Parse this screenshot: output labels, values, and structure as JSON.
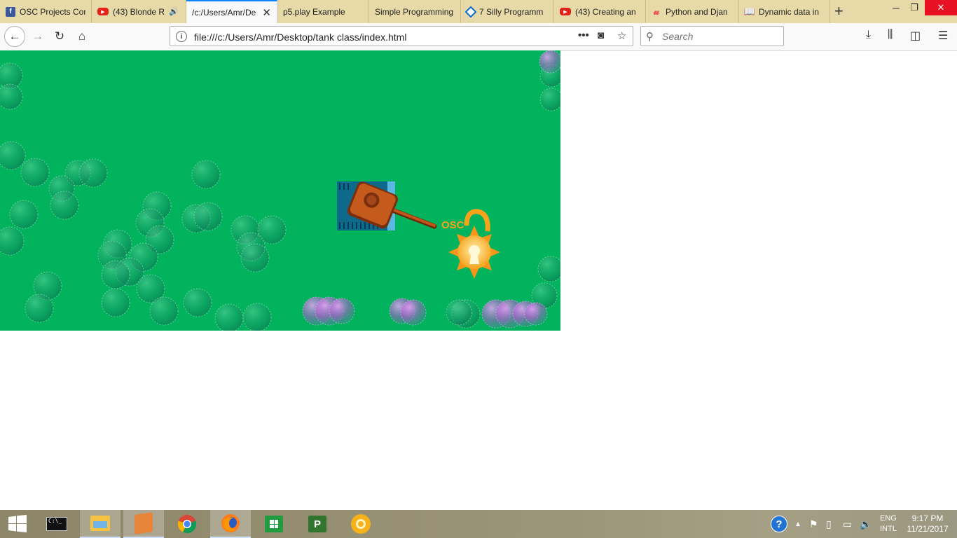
{
  "tabs": [
    {
      "title": "OSC Projects Cor",
      "icon": "facebook-icon"
    },
    {
      "title": "(43) Blonde R",
      "icon": "youtube-icon",
      "audio": true
    },
    {
      "title": "/c:/Users/Amr/De",
      "active": true
    },
    {
      "title": "p5.play Example",
      "icon": "page-icon"
    },
    {
      "title": "Simple Programming",
      "icon": "page-icon"
    },
    {
      "title": "7 Silly Programm",
      "icon": "diamond-icon"
    },
    {
      "title": "(43) Creating an",
      "icon": "youtube-icon"
    },
    {
      "title": "Python and Djan",
      "icon": "udemy-icon"
    },
    {
      "title": "Dynamic data in",
      "icon": "book-icon"
    }
  ],
  "nav": {
    "url": "file:///c:/Users/Amr/Desktop/tank class/index.html",
    "search_placeholder": "Search"
  },
  "game": {
    "badge_text": "OSC"
  },
  "tray": {
    "lang1": "ENG",
    "lang2": "INTL",
    "time": "9:17 PM",
    "date": "11/21/2017"
  },
  "colors": {
    "canvas_bg": "#00b35c",
    "tab_strip": "#e8d9a8",
    "accent": "#0a84ff"
  }
}
